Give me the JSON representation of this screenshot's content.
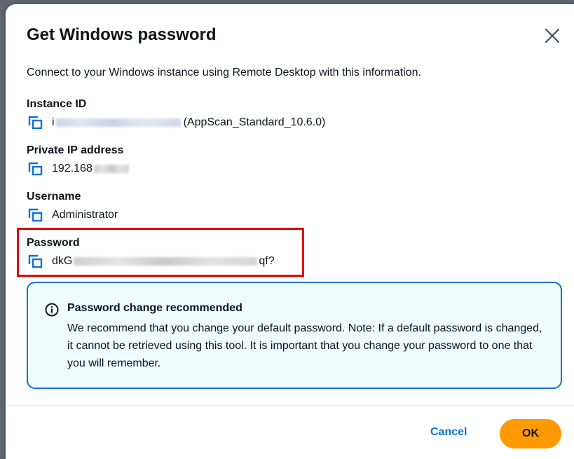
{
  "dialog": {
    "title": "Get Windows password",
    "intro": "Connect to your Windows instance using Remote Desktop with this information."
  },
  "fields": {
    "instance_id": {
      "label": "Instance ID",
      "value_prefix": "i",
      "value_suffix": "(AppScan_Standard_10.6.0)"
    },
    "private_ip": {
      "label": "Private IP address",
      "value_prefix": "192.168"
    },
    "username": {
      "label": "Username",
      "value": "Administrator"
    },
    "password": {
      "label": "Password",
      "value_prefix": "dkG",
      "value_suffix": "qf?"
    }
  },
  "alert": {
    "icon": "info-icon",
    "title": "Password change recommended",
    "body": "We recommend that you change your default password. Note: If a default password is changed, it cannot be retrieved using this tool. It is important that you change your password to one that you will remember."
  },
  "buttons": {
    "cancel": "Cancel",
    "ok": "OK"
  },
  "colors": {
    "accent": "#0972d3",
    "primary_button": "#ff9900",
    "highlight": "#e50000",
    "alert_bg": "#f0fbff"
  }
}
